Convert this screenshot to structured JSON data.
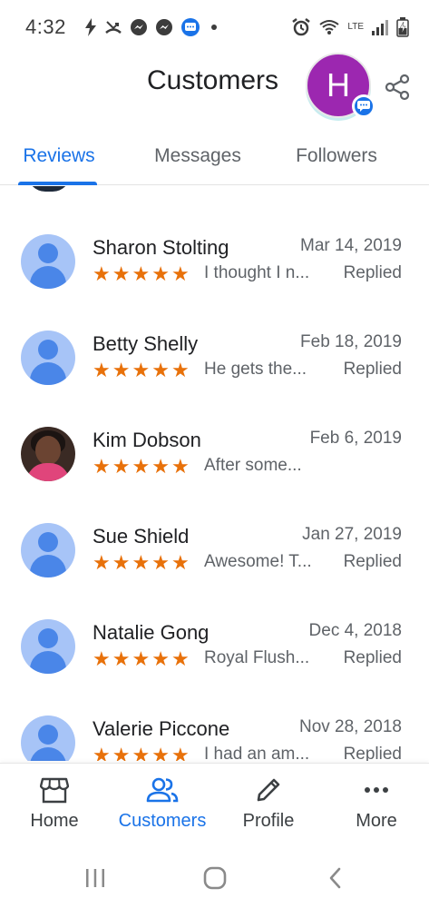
{
  "status_bar": {
    "time": "4:32",
    "network_label": "LTE"
  },
  "header": {
    "title": "Customers",
    "avatar_letter": "H",
    "avatar_color": "#9c27b0"
  },
  "tabs": [
    {
      "label": "Reviews",
      "active": true
    },
    {
      "label": "Messages",
      "active": false
    },
    {
      "label": "Followers",
      "active": false
    }
  ],
  "reviews": [
    {
      "name": "Sharon Stolting",
      "date": "Mar 14, 2019",
      "stars": 5,
      "snippet": "I thought I n...",
      "status": "Replied",
      "avatar": "placeholder"
    },
    {
      "name": "Betty Shelly",
      "date": "Feb 18, 2019",
      "stars": 5,
      "snippet": "He gets the...",
      "status": "Replied",
      "avatar": "placeholder"
    },
    {
      "name": "Kim Dobson",
      "date": "Feb 6, 2019",
      "stars": 5,
      "snippet": "After some...",
      "status": "",
      "avatar": "photo"
    },
    {
      "name": "Sue Shield",
      "date": "Jan 27, 2019",
      "stars": 5,
      "snippet": "Awesome! T...",
      "status": "Replied",
      "avatar": "placeholder"
    },
    {
      "name": "Natalie Gong",
      "date": "Dec 4, 2018",
      "stars": 5,
      "snippet": "Royal Flush...",
      "status": "Replied",
      "avatar": "placeholder"
    },
    {
      "name": "Valerie Piccone",
      "date": "Nov 28, 2018",
      "stars": 5,
      "snippet": "I had an am...",
      "status": "Replied",
      "avatar": "placeholder"
    }
  ],
  "bottom_nav": [
    {
      "label": "Home",
      "icon": "storefront-icon",
      "active": false
    },
    {
      "label": "Customers",
      "icon": "people-icon",
      "active": true
    },
    {
      "label": "Profile",
      "icon": "pencil-icon",
      "active": false
    },
    {
      "label": "More",
      "icon": "more-dots-icon",
      "active": false
    }
  ],
  "colors": {
    "accent": "#1a73e8",
    "star": "#e8710a",
    "avatar_placeholder_bg": "#a7c4f7",
    "avatar_placeholder_fg": "#4a86e8"
  }
}
